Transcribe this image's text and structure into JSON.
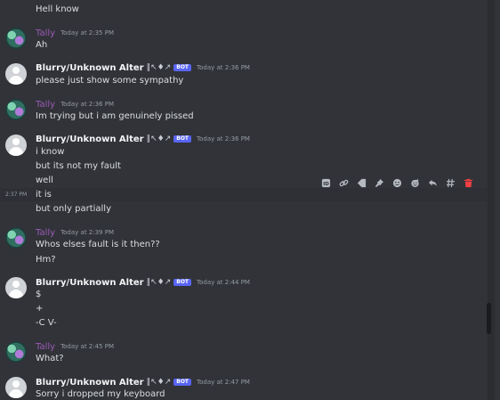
{
  "colors": {
    "background": "#313338",
    "tally_name": "#9b59b6",
    "bot_badge": "#5865f2",
    "delete_icon": "#f23f43"
  },
  "pre_line": "Hell know",
  "messages": [
    {
      "author": "Tally",
      "time": "Today at 2:35 PM",
      "lines": [
        "Ah"
      ]
    },
    {
      "author": "Blurry/Unknown Alter",
      "deco": "‖↖♦↗",
      "badge": "BOT",
      "time": "Today at 2:36 PM",
      "lines": [
        "please just show some sympathy"
      ]
    },
    {
      "author": "Tally",
      "time": "Today at 2:36 PM",
      "lines": [
        "Im trying but i am genuinely pissed"
      ]
    },
    {
      "author": "Blurry/Unknown Alter",
      "deco": "‖↖♦↗",
      "badge": "BOT",
      "time": "Today at 2:36 PM",
      "lines": [
        "i know",
        "but its not my fault",
        "well",
        "it is",
        "but only partially"
      ]
    },
    {
      "author": "Tally",
      "time": "Today at 2:39 PM",
      "lines": [
        "Whos elses fault is it then??",
        "Hm?"
      ]
    },
    {
      "author": "Blurry/Unknown Alter",
      "deco": "‖↖♦↗",
      "badge": "BOT",
      "time": "Today at 2:44 PM",
      "lines": [
        "$",
        "+",
        "-C V-"
      ]
    },
    {
      "author": "Tally",
      "time": "Today at 2:45 PM",
      "lines": [
        "What?"
      ]
    },
    {
      "author": "Blurry/Unknown Alter",
      "deco": "‖↖♦↗",
      "badge": "BOT",
      "time": "Today at 2:47 PM",
      "lines": [
        "Sorry i dropped my keyboard"
      ]
    }
  ],
  "hover_time": "2:37 PM",
  "toolbar": {
    "icons": [
      "id-icon",
      "link-icon",
      "mark-unread-icon",
      "pin-icon",
      "add-reaction-icon",
      "add-super-reaction-icon",
      "reply-icon",
      "create-thread-icon",
      "delete-icon"
    ]
  }
}
